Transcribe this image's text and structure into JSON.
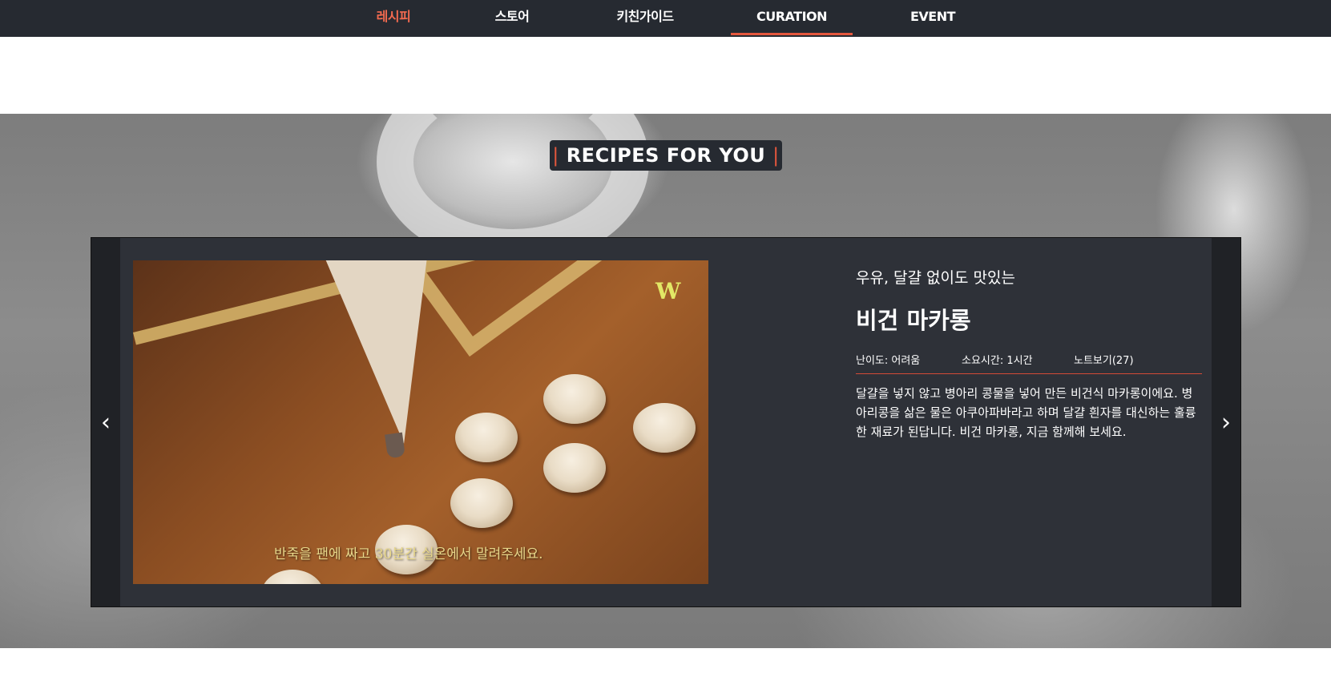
{
  "nav": {
    "items": [
      {
        "label": "레시피"
      },
      {
        "label": "스토어"
      },
      {
        "label": "키친가이드"
      },
      {
        "label": "CURATION"
      },
      {
        "label": "EVENT"
      }
    ],
    "active_color": "#f26a4f",
    "underline_color": "#e4573d"
  },
  "section": {
    "heading_bar_left": "|",
    "heading": "RECIPES FOR YOU",
    "heading_bar_right": "|"
  },
  "slide": {
    "photo": {
      "watermark": "W",
      "caption": "반죽을 팬에 짜고 30분간 실온에서 말려주세요."
    },
    "subtitle": "우유, 달걀 없이도 맛있는",
    "title": "비건 마카롱",
    "meta": {
      "difficulty": "난이도: 어려움",
      "time": "소요시간: 1시간",
      "notes": "노트보기(27)"
    },
    "description": "달걀을 넣지 않고 병아리 콩물을 넣어 만든 비건식 마카롱이에요. 병아리콩을 삶은 물은 아쿠아파바라고 하며 달걀 흰자를 대신하는 훌륭한 재료가 된답니다. 비건 마카롱, 지금 함께해 보세요."
  },
  "controls": {
    "prev_icon": "chevron-left-icon",
    "next_icon": "chevron-right-icon",
    "prev_glyph": "‹",
    "next_glyph": "›"
  }
}
